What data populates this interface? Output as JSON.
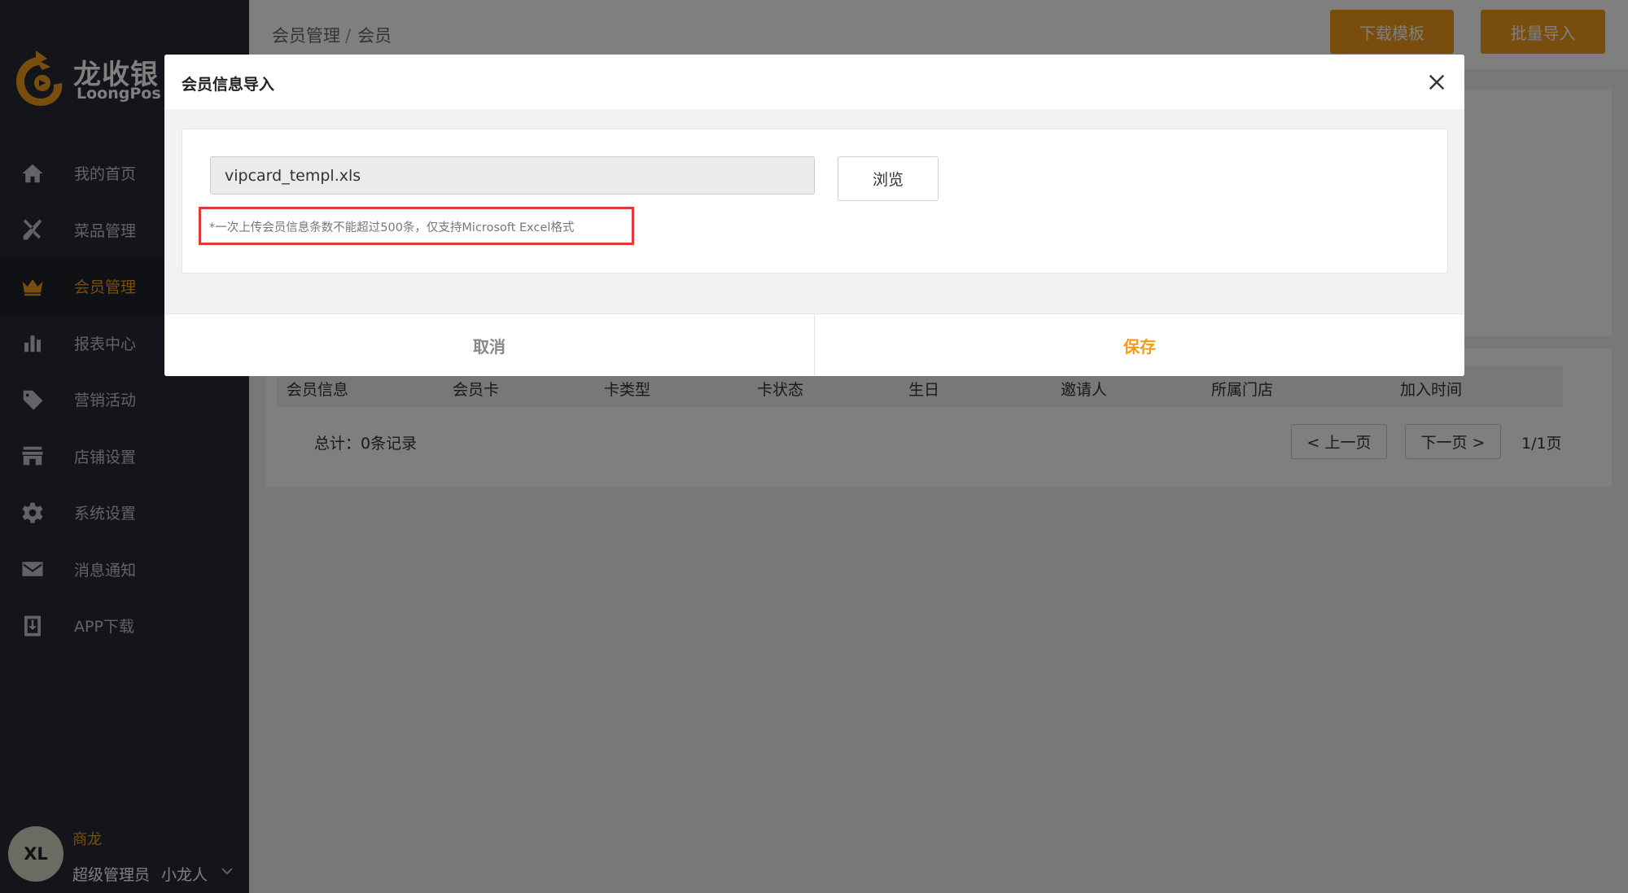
{
  "app": {
    "logo_cn": "龙收银",
    "logo_en": "LoongPos"
  },
  "sidebar": {
    "items": [
      {
        "label": "我的首页",
        "icon": "home-icon"
      },
      {
        "label": "菜品管理",
        "icon": "utensils-icon"
      },
      {
        "label": "会员管理",
        "icon": "crown-icon",
        "active": true
      },
      {
        "label": "报表中心",
        "icon": "bar-chart-icon"
      },
      {
        "label": "营销活动",
        "icon": "tag-icon"
      },
      {
        "label": "店铺设置",
        "icon": "store-icon"
      },
      {
        "label": "系统设置",
        "icon": "gear-icon"
      },
      {
        "label": "消息通知",
        "icon": "mail-icon"
      },
      {
        "label": "APP下载",
        "icon": "download-icon"
      }
    ],
    "user": {
      "initials": "XL",
      "shop": "商龙",
      "role": "超级管理员",
      "name": "小龙人"
    }
  },
  "header": {
    "breadcrumb": [
      "会员管理",
      "会员"
    ],
    "separator": "/",
    "download_template_label": "下载模板",
    "batch_import_label": "批量导入"
  },
  "table": {
    "columns": [
      "会员信息",
      "会员卡",
      "卡类型",
      "卡状态",
      "生日",
      "邀请人",
      "所属门店",
      "加入时间"
    ],
    "total": "总计：0条记录",
    "prev_label": "< 上一页",
    "next_label": "下一页 >",
    "page_info": "1/1页"
  },
  "modal": {
    "title": "会员信息导入",
    "file_value": "vipcard_templ.xls",
    "browse_label": "浏览",
    "note": "*一次上传会员信息条数不能超过500条，仅支持Microsoft Excel格式",
    "cancel_label": "取消",
    "save_label": "保存"
  },
  "colors": {
    "accent": "#f39b1d",
    "sidebar_bg": "#262b36",
    "highlight_border": "#e03a3a"
  }
}
